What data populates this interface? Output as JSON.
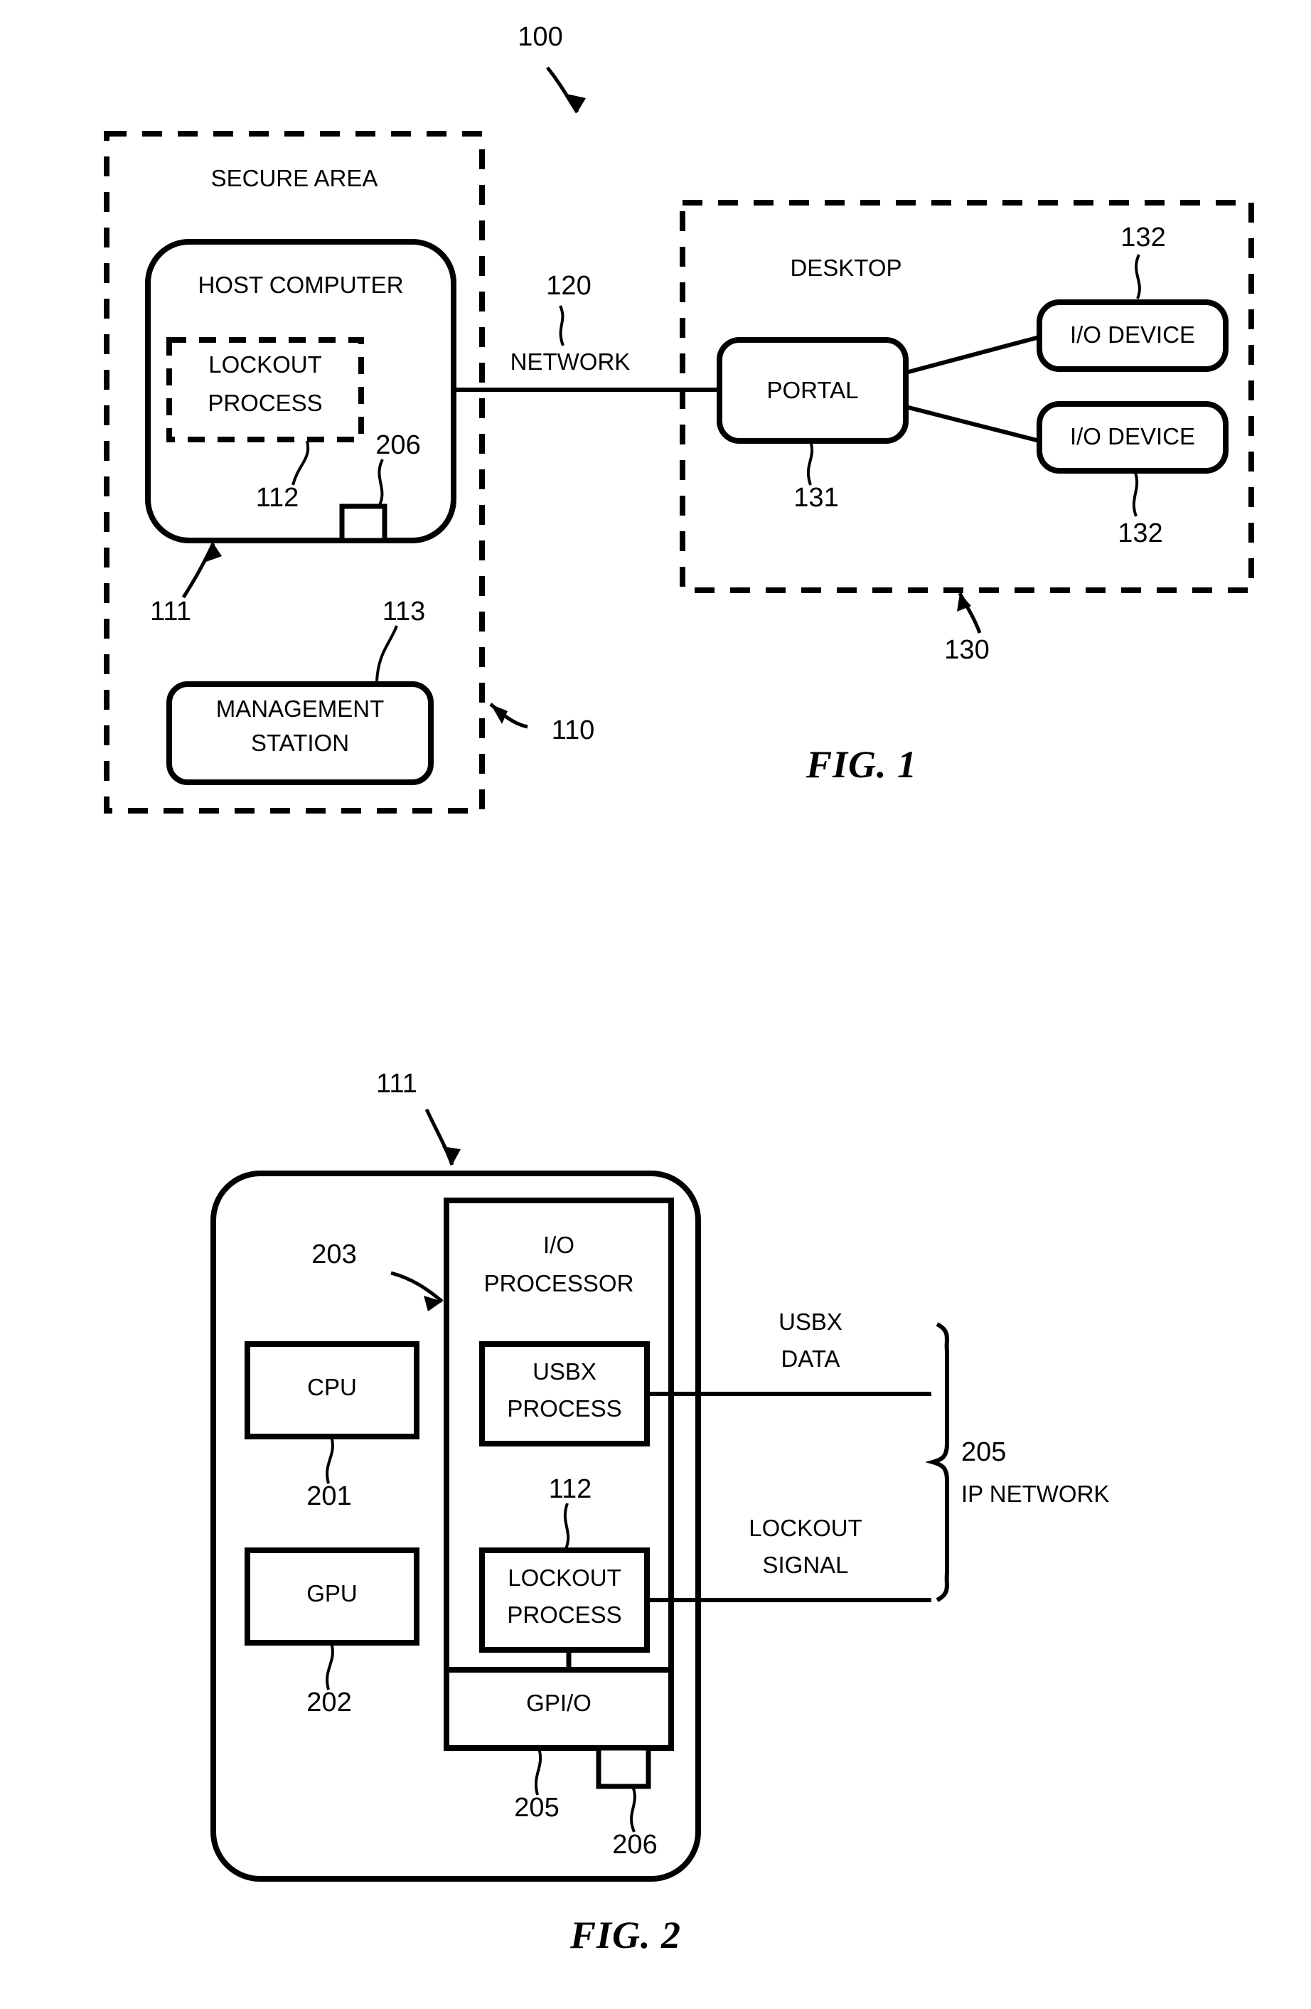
{
  "sheet": {
    "background": "#ffffff",
    "ink": "#000000"
  },
  "figures": [
    {
      "id": "fig1",
      "caption": "FIG. 1",
      "system_ref": "100",
      "groups": [
        {
          "name": "secure-area",
          "label": "SECURE AREA",
          "ref": "110",
          "style": "dashed"
        },
        {
          "name": "desktop",
          "label": "DESKTOP",
          "ref": "130",
          "style": "dashed"
        }
      ],
      "nodes": [
        {
          "name": "host-computer",
          "label": "HOST COMPUTER",
          "ref": "111",
          "style": "rounded-solid"
        },
        {
          "name": "lockout-process",
          "label": "LOCKOUT\nPROCESS",
          "label_lines": [
            "LOCKOUT",
            "PROCESS"
          ],
          "ref": "112",
          "style": "dashed"
        },
        {
          "name": "connector-206",
          "label": "",
          "ref": "206",
          "style": "rect-solid"
        },
        {
          "name": "management-station",
          "label": "MANAGEMENT\nSTATION",
          "label_lines": [
            "MANAGEMENT",
            "STATION"
          ],
          "ref": "113",
          "style": "rounded-solid"
        },
        {
          "name": "portal",
          "label": "PORTAL",
          "ref": "131",
          "style": "rounded-solid"
        },
        {
          "name": "io-device-top",
          "label": "I/O DEVICE",
          "ref": "132",
          "style": "rounded-solid"
        },
        {
          "name": "io-device-bottom",
          "label": "I/O DEVICE",
          "ref": "132",
          "style": "rounded-solid"
        }
      ],
      "links": [
        {
          "name": "network-link",
          "label": "NETWORK",
          "ref": "120"
        }
      ]
    },
    {
      "id": "fig2",
      "caption": "FIG. 2",
      "host_ref": "111",
      "nodes": [
        {
          "name": "io-processor",
          "label": "I/O\nPROCESSOR",
          "label_lines": [
            "I/O",
            "PROCESSOR"
          ],
          "ref": "203",
          "style": "rect-solid"
        },
        {
          "name": "cpu",
          "label": "CPU",
          "ref": "201",
          "style": "rect-solid"
        },
        {
          "name": "gpu",
          "label": "GPU",
          "ref": "202",
          "style": "rect-solid"
        },
        {
          "name": "usbx-process",
          "label": "USBX\nPROCESS",
          "label_lines": [
            "USBX",
            "PROCESS"
          ],
          "ref": "",
          "style": "rect-solid"
        },
        {
          "name": "lockout-process",
          "label": "LOCKOUT\nPROCESS",
          "label_lines": [
            "LOCKOUT",
            "PROCESS"
          ],
          "ref": "112",
          "style": "rect-solid"
        },
        {
          "name": "gpio",
          "label": "GPI/O",
          "ref": "205",
          "style": "rect-solid"
        },
        {
          "name": "connector-206",
          "label": "",
          "ref": "206",
          "style": "rect-solid"
        }
      ],
      "signals": [
        {
          "name": "usbx-data-signal",
          "label_lines": [
            "USBX",
            "DATA"
          ]
        },
        {
          "name": "lockout-signal",
          "label_lines": [
            "LOCKOUT",
            "SIGNAL"
          ]
        }
      ],
      "bracket": {
        "name": "ip-network-bracket",
        "ref": "205",
        "label": "IP NETWORK"
      }
    }
  ],
  "text": {
    "fig1": {
      "caption": "FIG. 1",
      "system_ref": "100",
      "secure_area": "SECURE AREA",
      "secure_area_ref": "110",
      "host_computer": "HOST COMPUTER",
      "host_computer_ref": "111",
      "lockout_l1": "LOCKOUT",
      "lockout_l2": "PROCESS",
      "lockout_ref": "112",
      "connector_ref": "206",
      "management_l1": "MANAGEMENT",
      "management_l2": "STATION",
      "management_ref": "113",
      "network": "NETWORK",
      "network_ref": "120",
      "desktop": "DESKTOP",
      "desktop_ref": "130",
      "portal": "PORTAL",
      "portal_ref": "131",
      "io_device_1": "I/O DEVICE",
      "io_device_1_ref": "132",
      "io_device_2": "I/O DEVICE",
      "io_device_2_ref": "132"
    },
    "fig2": {
      "caption": "FIG. 2",
      "host_ref": "111",
      "io_processor_l1": "I/O",
      "io_processor_l2": "PROCESSOR",
      "io_processor_ref": "203",
      "cpu": "CPU",
      "cpu_ref": "201",
      "gpu": "GPU",
      "gpu_ref": "202",
      "usbx_l1": "USBX",
      "usbx_l2": "PROCESS",
      "lockout_l1": "LOCKOUT",
      "lockout_l2": "PROCESS",
      "lockout_ref": "112",
      "gpio": "GPI/O",
      "gpio_ref": "205",
      "connector_ref": "206",
      "usbx_data_l1": "USBX",
      "usbx_data_l2": "DATA",
      "lockout_signal_l1": "LOCKOUT",
      "lockout_signal_l2": "SIGNAL",
      "ip_network_ref": "205",
      "ip_network": "IP NETWORK"
    }
  }
}
